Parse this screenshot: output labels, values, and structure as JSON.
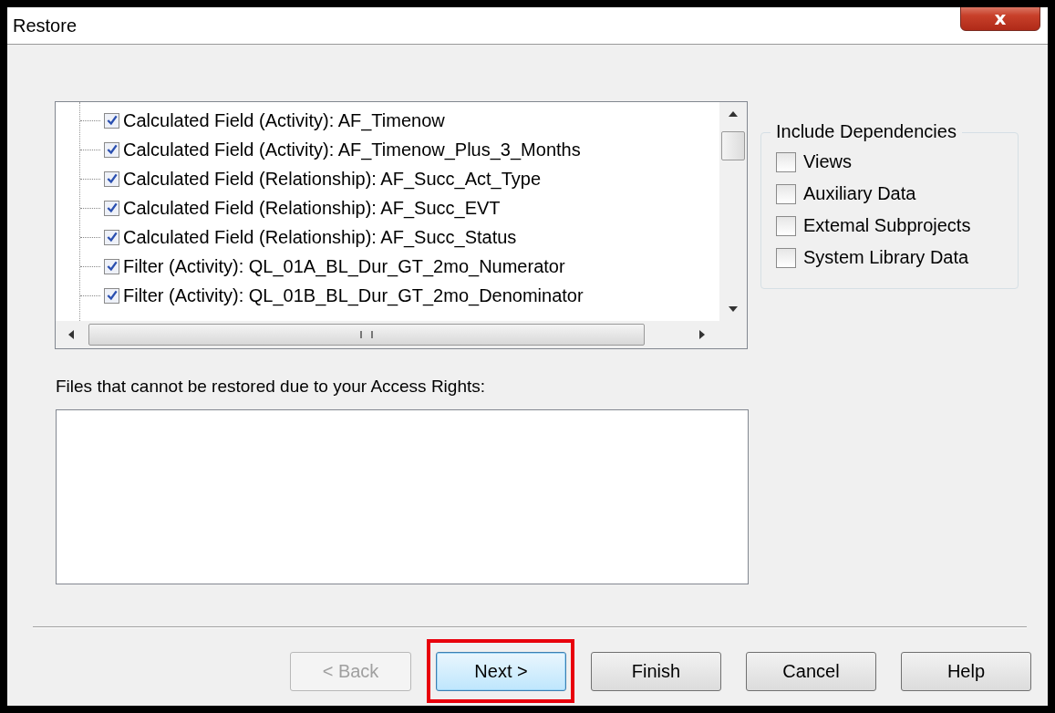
{
  "window": {
    "title": "Restore",
    "close_button": "x"
  },
  "tree": {
    "items": [
      {
        "label": "Calculated Field (Activity): AF_Timenow",
        "checked": true
      },
      {
        "label": "Calculated Field (Activity): AF_Timenow_Plus_3_Months",
        "checked": true
      },
      {
        "label": "Calculated Field (Relationship): AF_Succ_Act_Type",
        "checked": true
      },
      {
        "label": "Calculated Field (Relationship): AF_Succ_EVT",
        "checked": true
      },
      {
        "label": "Calculated Field (Relationship): AF_Succ_Status",
        "checked": true
      },
      {
        "label": "Filter (Activity): QL_01A_BL_Dur_GT_2mo_Numerator",
        "checked": true
      },
      {
        "label": "Filter (Activity): QL_01B_BL_Dur_GT_2mo_Denominator",
        "checked": true
      }
    ]
  },
  "dependencies": {
    "title": "Include Dependencies",
    "options": [
      {
        "label": "Views",
        "checked": false
      },
      {
        "label": "Auxiliary Data",
        "checked": false
      },
      {
        "label": "Extemal Subprojects",
        "checked": false
      },
      {
        "label": "System Library Data",
        "checked": false
      }
    ]
  },
  "restricted_files": {
    "label": "Files that cannot be restored due to your Access Rights:"
  },
  "buttons": [
    {
      "label": "< Back",
      "disabled": true,
      "default": false,
      "highlighted": false
    },
    {
      "label": "Next >",
      "disabled": false,
      "default": true,
      "highlighted": true
    },
    {
      "label": "Finish",
      "disabled": false,
      "default": false,
      "highlighted": false
    },
    {
      "label": "Cancel",
      "disabled": false,
      "default": false,
      "highlighted": false
    },
    {
      "label": "Help",
      "disabled": false,
      "default": false,
      "highlighted": false
    }
  ]
}
